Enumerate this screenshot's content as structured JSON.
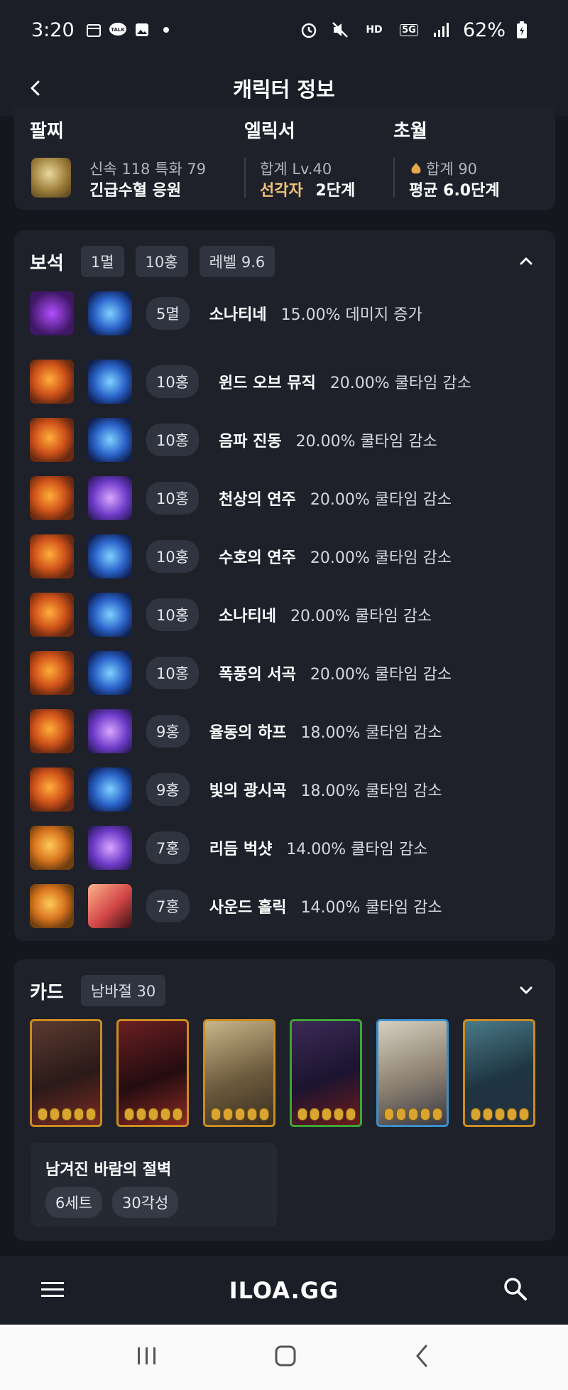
{
  "status_bar": {
    "time": "3:20",
    "battery": "62%",
    "icons": [
      "calendar-icon",
      "talk-icon",
      "gallery-icon",
      "dot-icon",
      "alarm-icon",
      "mute-icon",
      "hd-voice-icon",
      "5g-icon",
      "signal-icon",
      "battery-icon"
    ],
    "hd_label": "HD",
    "net_label": "5G"
  },
  "app_bar": {
    "title": "캐릭터 정보"
  },
  "top_section": {
    "col1_head": "팔찌",
    "col1_line1": "신속 118  특화 79",
    "col1_line2": "긴급수혈  응원",
    "col2_head": "엘릭서",
    "col2_line1": "합계 Lv.40",
    "col2_highlight": "선각자",
    "col2_step": "2단계",
    "col3_head": "초월",
    "col3_line1": "합계 90",
    "col3_line2": "평균 6.0단계"
  },
  "gems": {
    "title": "보석",
    "chips": [
      "1멸",
      "10홍",
      "레벨 9.6"
    ],
    "rows": [
      {
        "level": "5멸",
        "name": "소나티네",
        "effect": "15.00% 데미지 증가",
        "type": "dmg",
        "skill_style": "blue"
      },
      {
        "level": "10홍",
        "name": "윈드 오브 뮤직",
        "effect": "20.00% 쿨타임 감소",
        "type": "cd",
        "skill_style": "blue"
      },
      {
        "level": "10홍",
        "name": "음파 진동",
        "effect": "20.00% 쿨타임 감소",
        "type": "cd",
        "skill_style": "blue"
      },
      {
        "level": "10홍",
        "name": "천상의 연주",
        "effect": "20.00% 쿨타임 감소",
        "type": "cd",
        "skill_style": "purple"
      },
      {
        "level": "10홍",
        "name": "수호의 연주",
        "effect": "20.00% 쿨타임 감소",
        "type": "cd",
        "skill_style": "blue"
      },
      {
        "level": "10홍",
        "name": "소나티네",
        "effect": "20.00% 쿨타임 감소",
        "type": "cd",
        "skill_style": "blue"
      },
      {
        "level": "10홍",
        "name": "폭풍의 서곡",
        "effect": "20.00% 쿨타임 감소",
        "type": "cd",
        "skill_style": "blue"
      },
      {
        "level": "9홍",
        "name": "율동의 하프",
        "effect": "18.00% 쿨타임 감소",
        "type": "cd",
        "skill_style": "purple"
      },
      {
        "level": "9홍",
        "name": "빛의 광시곡",
        "effect": "18.00% 쿨타임 감소",
        "type": "cd",
        "skill_style": "blue"
      },
      {
        "level": "7홍",
        "name": "리듬 벅샷",
        "effect": "14.00% 쿨타임 감소",
        "type": "cd-low",
        "skill_style": "purple"
      },
      {
        "level": "7홍",
        "name": "사운드 홀릭",
        "effect": "14.00% 쿨타임 감소",
        "type": "cd-low",
        "skill_style": "red"
      }
    ]
  },
  "cards": {
    "title": "카드",
    "chip": "남바절 30",
    "card_borders": [
      "orange",
      "orange",
      "orange",
      "green",
      "blue",
      "orange"
    ],
    "set_name": "남겨진 바람의 절벽",
    "set_chips": [
      "6세트",
      "30각성"
    ]
  },
  "bottom_bar": {
    "logo": "ILOA.GG"
  },
  "nav_bar": {
    "items": [
      "recent-apps-icon",
      "home-icon",
      "back-icon"
    ]
  }
}
